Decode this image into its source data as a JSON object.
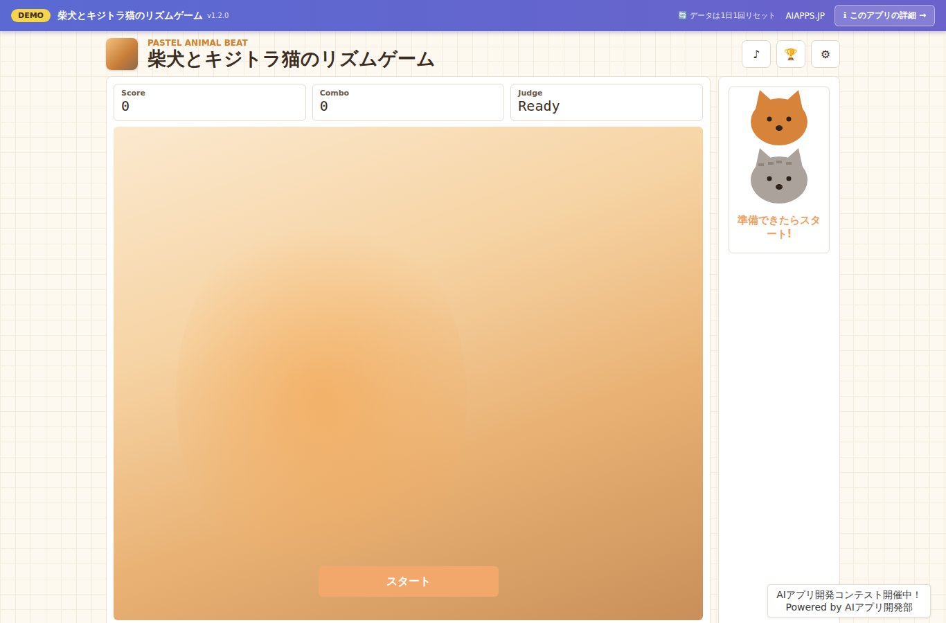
{
  "topbar": {
    "badge": "DEMO",
    "title": "柴犬とキジトラ猫のリズムゲーム",
    "version": "v1.2.0",
    "notice": "🔄 データは1日1回リセット",
    "site": "AIAPPS.JP",
    "details_button": "ℹ このアプリの詳細 →"
  },
  "header": {
    "subtitle": "PASTEL ANIMAL BEAT",
    "title": "柴犬とキジトラ猫のリズムゲーム",
    "buttons": [
      "♪",
      "🏆",
      "⚙"
    ]
  },
  "stats": [
    {
      "label": "Score",
      "value": "0"
    },
    {
      "label": "Combo",
      "value": "0"
    },
    {
      "label": "Judge",
      "value": "Ready"
    }
  ],
  "game": {
    "start_button": "スタート"
  },
  "side_panel": {
    "message": "準備できたらスタート!"
  },
  "footer_badge": {
    "line1": "AIアプリ開発コンテスト開催中！",
    "line2": "Powered by AIアプリ開発部"
  }
}
